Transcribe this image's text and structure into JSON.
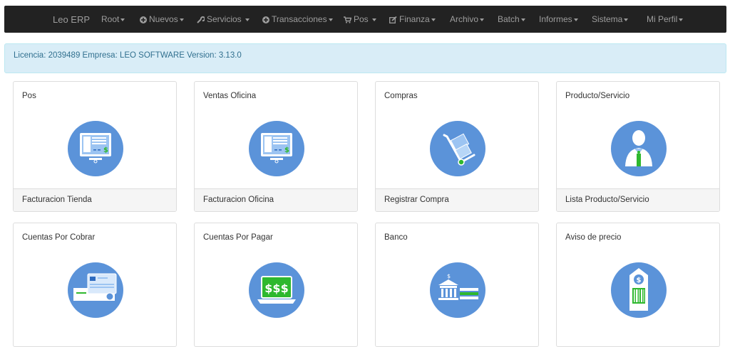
{
  "nav": {
    "brand": "Leo ERP",
    "items": [
      {
        "label": "Root",
        "icon": ""
      },
      {
        "label": "Nuevos",
        "icon": "plus-circle-icon"
      },
      {
        "label": "Servicios",
        "icon": "wrench-icon"
      },
      {
        "label": "Transacciones",
        "icon": "plus-circle-icon"
      },
      {
        "label": "Pos",
        "icon": "cart-icon"
      },
      {
        "label": "Finanza",
        "icon": "edit-icon"
      },
      {
        "label": "Archivo",
        "icon": ""
      },
      {
        "label": "Batch",
        "icon": ""
      },
      {
        "label": "Informes",
        "icon": ""
      },
      {
        "label": "Sistema",
        "icon": ""
      },
      {
        "label": "Mi Perfil",
        "icon": ""
      }
    ]
  },
  "alert": {
    "text": "Licencia: 2039489 Empresa: LEO SOFTWARE Version: 3.13.0"
  },
  "panels": [
    {
      "title": "Pos",
      "footer": "Facturacion Tienda",
      "icon": "monitor-invoice-icon"
    },
    {
      "title": "Ventas Oficina",
      "footer": "Facturacion Oficina",
      "icon": "monitor-invoice-icon"
    },
    {
      "title": "Compras",
      "footer": "Registrar Compra",
      "icon": "hand-truck-icon"
    },
    {
      "title": "Producto/Servicio",
      "footer": "Lista Producto/Servicio",
      "icon": "person-icon"
    },
    {
      "title": "Cuentas Por Cobrar",
      "footer": "",
      "icon": "credit-card-icon"
    },
    {
      "title": "Cuentas Por Pagar",
      "footer": "",
      "icon": "laptop-money-icon"
    },
    {
      "title": "Banco",
      "footer": "",
      "icon": "bank-icon"
    },
    {
      "title": "Aviso de precio",
      "footer": "",
      "icon": "price-tag-icon"
    }
  ],
  "colors": {
    "navbar": "#222222",
    "nav_text": "#9d9d9d",
    "alert_bg": "#d9edf7",
    "alert_text": "#31708f",
    "icon_circle": "#5b93d9",
    "icon_green": "#2eb82e"
  }
}
